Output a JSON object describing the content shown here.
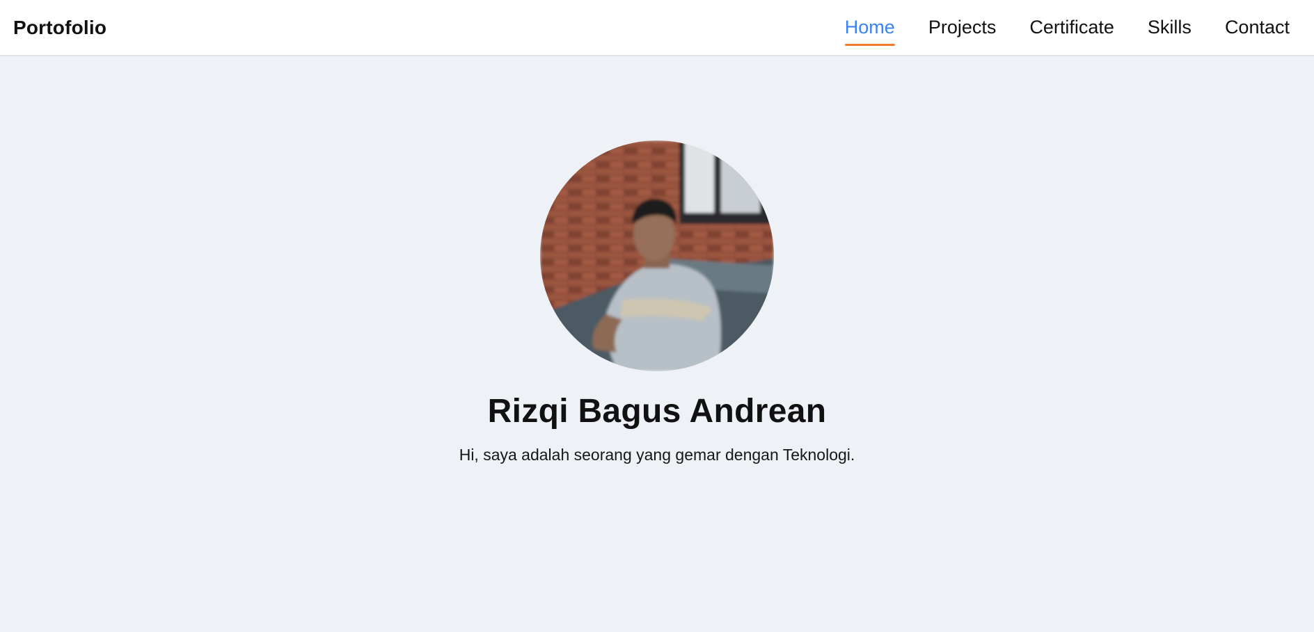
{
  "brand": {
    "title": "Portofolio"
  },
  "nav": {
    "items": [
      {
        "label": "Home",
        "active": true
      },
      {
        "label": "Projects",
        "active": false
      },
      {
        "label": "Certificate",
        "active": false
      },
      {
        "label": "Skills",
        "active": false
      },
      {
        "label": "Contact",
        "active": false
      }
    ]
  },
  "hero": {
    "name": "Rizqi Bagus Andrean",
    "tagline": "Hi, saya adalah seorang yang gemar dengan Teknologi."
  },
  "colors": {
    "active_link": "#3b82f6",
    "active_underline": "#f07a2c",
    "page_background": "#eef2f7",
    "navbar_background": "#ffffff"
  }
}
